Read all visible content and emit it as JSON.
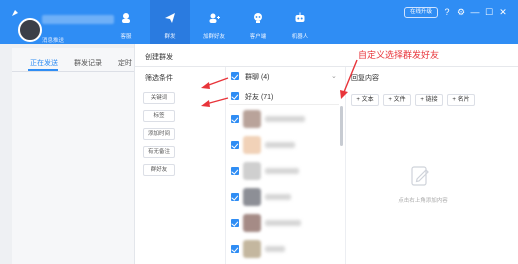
{
  "topbar": {
    "user_sub": "消息推送",
    "nav": [
      {
        "label": "客服",
        "icon": "headset-icon"
      },
      {
        "label": "群发",
        "icon": "send-icon"
      },
      {
        "label": "加群好友",
        "icon": "add-friend-icon"
      },
      {
        "label": "客户端",
        "icon": "client-icon"
      },
      {
        "label": "机器人",
        "icon": "robot-icon"
      }
    ],
    "upgrade_label": "在线升级",
    "window_icons": [
      "help-icon",
      "settings-icon",
      "minimize-icon",
      "maximize-icon",
      "close-icon"
    ]
  },
  "tabs": [
    "正在发送",
    "群发记录",
    "定时"
  ],
  "dialog": {
    "title": "创建群发",
    "filter_title": "筛选条件",
    "filters": [
      "关键词",
      "标签",
      "添加时间",
      "有无备注",
      "群好友"
    ],
    "group_label": "群聊 (4)",
    "friend_label": "好友 (71)",
    "reply_title": "回复内容",
    "reply_buttons": [
      "+ 文本",
      "+ 文件",
      "+ 链接",
      "+ 名片"
    ],
    "empty_text": "点击右上角添加内容"
  },
  "annotation": {
    "text": "自定义选择群发好友",
    "color": "#e8343a"
  },
  "colors": {
    "accent": "#2f8df4"
  }
}
